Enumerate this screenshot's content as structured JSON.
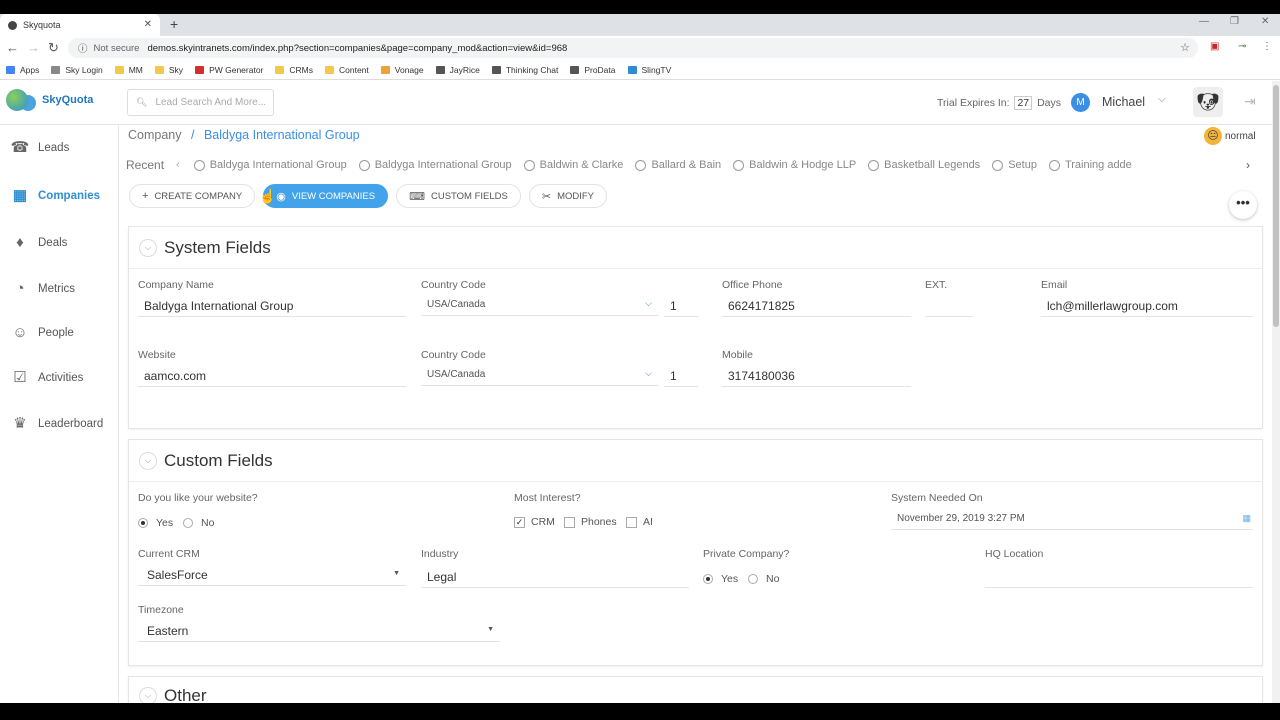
{
  "browser": {
    "tab_title": "Skyquota",
    "url_not_secure": "Not secure",
    "url": "demos.skyintranets.com/index.php?section=companies&page=company_mod&action=view&id=968",
    "bookmarks": [
      {
        "label": "Apps",
        "color": "#4285f4"
      },
      {
        "label": "Sky Login",
        "color": "#888888"
      },
      {
        "label": "MM",
        "color": "#f2c94c"
      },
      {
        "label": "Sky",
        "color": "#f2c94c"
      },
      {
        "label": "PW Generator",
        "color": "#d32f2f"
      },
      {
        "label": "CRMs",
        "color": "#f2c94c"
      },
      {
        "label": "Content",
        "color": "#f2c94c"
      },
      {
        "label": "Vonage",
        "color": "#e8a33a"
      },
      {
        "label": "JayRice",
        "color": "#555555"
      },
      {
        "label": "Thinking Chat",
        "color": "#555555"
      },
      {
        "label": "ProData",
        "color": "#555555"
      },
      {
        "label": "SlingTV",
        "color": "#2e8bd6"
      }
    ]
  },
  "header": {
    "logo_text": "SkyQuota",
    "search_placeholder": "Lead Search And More...",
    "trial_prefix": "Trial Expires In:",
    "trial_days": "27",
    "trial_suffix": "Days",
    "user_initial": "M",
    "user_name": "Michael"
  },
  "sidebar": {
    "items": [
      {
        "label": "Leads",
        "icon": "leads-icon",
        "glyph": "☎"
      },
      {
        "label": "Companies",
        "icon": "companies-icon",
        "glyph": "▦"
      },
      {
        "label": "Deals",
        "icon": "deals-icon",
        "glyph": "♦"
      },
      {
        "label": "Metrics",
        "icon": "metrics-icon",
        "glyph": "◔"
      },
      {
        "label": "People",
        "icon": "people-icon",
        "glyph": "☺"
      },
      {
        "label": "Activities",
        "icon": "activities-icon",
        "glyph": "☑"
      },
      {
        "label": "Leaderboard",
        "icon": "leaderboard-icon",
        "glyph": "♛"
      }
    ],
    "active": "Companies"
  },
  "breadcrumb": {
    "parent": "Company",
    "separator": "/",
    "current": "Baldyga International Group"
  },
  "mood": {
    "label": "normal"
  },
  "recent": {
    "label": "Recent",
    "items": [
      "Baldyga International Group",
      "Baldyga International Group",
      "Baldwin & Clarke",
      "Ballard & Bain",
      "Baldwin & Hodge LLP",
      "Basketball Legends",
      "Setup",
      "Training adde"
    ]
  },
  "actions": {
    "create": "CREATE COMPANY",
    "view": "VIEW COMPANIES",
    "custom": "CUSTOM FIELDS",
    "modify": "MODIFY",
    "more": "•••"
  },
  "system_fields": {
    "title": "System Fields",
    "company_name_label": "Company Name",
    "company_name": "Baldyga International Group",
    "country_code_label": "Country Code",
    "country_code": "USA/Canada",
    "country_num": "1",
    "office_phone_label": "Office Phone",
    "office_phone": "6624171825",
    "ext_label": "EXT.",
    "email_label": "Email",
    "email": "lch@millerlawgroup.com",
    "website_label": "Website",
    "website": "aamco.com",
    "country_code2_label": "Country Code",
    "country_code2": "USA/Canada",
    "country_num2": "1",
    "mobile_label": "Mobile",
    "mobile": "3174180036"
  },
  "custom_fields": {
    "title": "Custom Fields",
    "website_q": "Do you like your website?",
    "yes": "Yes",
    "no": "No",
    "most_interest": "Most Interest?",
    "opt_crm": "CRM",
    "opt_phones": "Phones",
    "opt_ai": "AI",
    "system_needed_label": "System Needed On",
    "system_needed": "November 29, 2019 3:27 PM",
    "current_crm_label": "Current CRM",
    "current_crm": "SalesForce",
    "industry_label": "Industry",
    "industry": "Legal",
    "private_label": "Private Company?",
    "private_yes": "Yes",
    "private_no": "No",
    "hq_label": "HQ Location",
    "timezone_label": "Timezone",
    "timezone": "Eastern"
  },
  "other": {
    "title": "Other"
  },
  "colors": {
    "accent": "#3a8ee6",
    "primary_button": "#42a3ea"
  }
}
